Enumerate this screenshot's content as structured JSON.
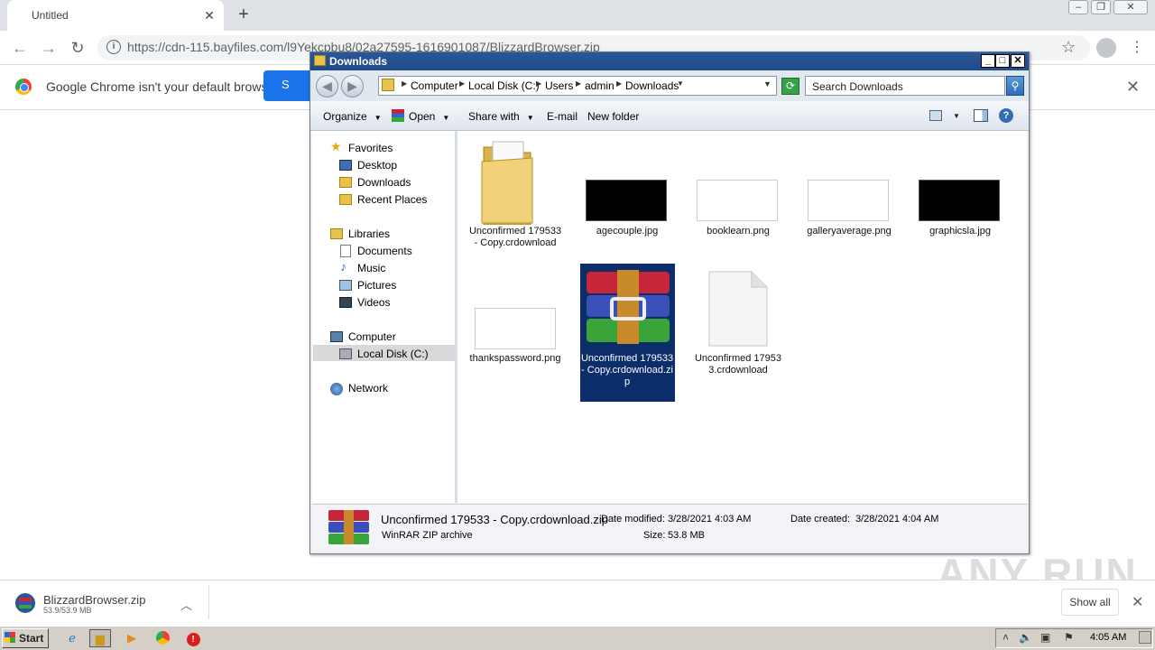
{
  "browser": {
    "tab_title": "Untitled",
    "url": "https://cdn-115.bayfiles.com/l9Yekcpbu8/02a27595-1616901087/BlizzardBrowser.zip",
    "infobar_text": "Google Chrome isn't your default browser",
    "infobar_button": "S"
  },
  "explorer": {
    "title": "Downloads",
    "breadcrumb": [
      "Computer",
      "Local Disk (C:)",
      "Users",
      "admin",
      "Downloads"
    ],
    "search_placeholder": "Search Downloads",
    "commands": [
      "Organize",
      "Open",
      "Share with",
      "E-mail",
      "New folder"
    ],
    "nav": {
      "favorites": "Favorites",
      "desktop": "Desktop",
      "downloads": "Downloads",
      "recent": "Recent Places",
      "libraries": "Libraries",
      "documents": "Documents",
      "music": "Music",
      "pictures": "Pictures",
      "videos": "Videos",
      "computer": "Computer",
      "local_disk": "Local Disk (C:)",
      "network": "Network"
    },
    "files": [
      {
        "name": "Unconfirmed 179533 - Copy.crdownload"
      },
      {
        "name": "agecouple.jpg"
      },
      {
        "name": "booklearn.png"
      },
      {
        "name": "galleryaverage.png"
      },
      {
        "name": "graphicsla.jpg"
      },
      {
        "name": "thankspassword.png"
      },
      {
        "name": "Unconfirmed 179533 - Copy.crdownload.zip"
      },
      {
        "name": "Unconfirmed 179533.crdownload"
      }
    ],
    "details": {
      "name": "Unconfirmed 179533 - Copy.crdownload.zip",
      "type": "WinRAR ZIP archive",
      "modified_label": "Date modified:",
      "modified": "3/28/2021 4:03 AM",
      "created_label": "Date created:",
      "created": "3/28/2021 4:04 AM",
      "size_label": "Size:",
      "size": "53.8 MB"
    }
  },
  "downloads_shelf": {
    "file_name": "BlizzardBrowser.zip",
    "progress": "53.9/53.9 MB",
    "show_all": "Show all"
  },
  "watermark": "ANY RUN",
  "taskbar": {
    "start": "Start",
    "clock": "4:05 AM"
  }
}
